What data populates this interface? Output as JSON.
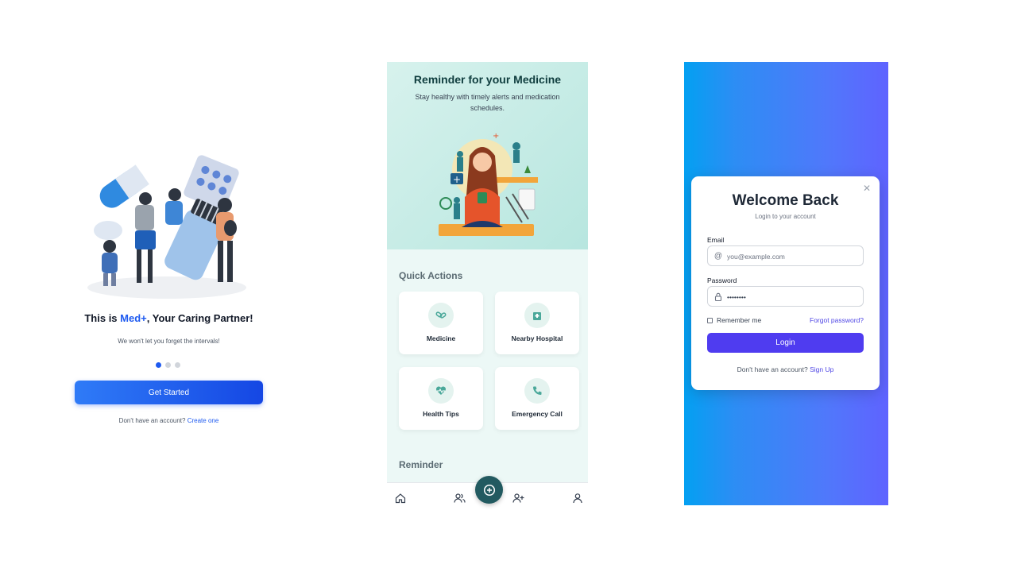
{
  "onboarding": {
    "title_prefix": "This is ",
    "brand": "Med+",
    "title_suffix": ", Your Caring Partner!",
    "subtitle": "We won't let you forget the intervals!",
    "pager": {
      "total": 3,
      "active": 1
    },
    "cta": "Get Started",
    "footer_text": "Don't have an account?",
    "footer_link": "Create one"
  },
  "home": {
    "hero_title": "Reminder for your Medicine",
    "hero_subtitle": "Stay healthy with timely alerts and medication schedules.",
    "quick_actions_title": "Quick Actions",
    "actions": [
      {
        "label": "Medicine",
        "icon": "pills-icon"
      },
      {
        "label": "Nearby Hospital",
        "icon": "hospital-icon"
      },
      {
        "label": "Health Tips",
        "icon": "heartbeat-icon"
      },
      {
        "label": "Emergency Call",
        "icon": "phone-icon"
      }
    ],
    "reminder_title": "Reminder",
    "nav": [
      "home-icon",
      "users-icon",
      "add-circle-icon",
      "user-plus-icon",
      "profile-icon"
    ]
  },
  "login": {
    "title": "Welcome Back",
    "subtitle": "Login to your account",
    "email_label": "Email",
    "email_placeholder": "you@example.com",
    "password_label": "Password",
    "password_value": "••••••••",
    "remember_label": "Remember me",
    "forgot_link": "Forgot password?",
    "button": "Login",
    "footer_text": "Don't have an account?",
    "footer_link": "Sign Up"
  },
  "colors": {
    "brand_blue": "#1e5af0",
    "teal_dark": "#225a60",
    "login_purple": "#4f3cf0"
  }
}
